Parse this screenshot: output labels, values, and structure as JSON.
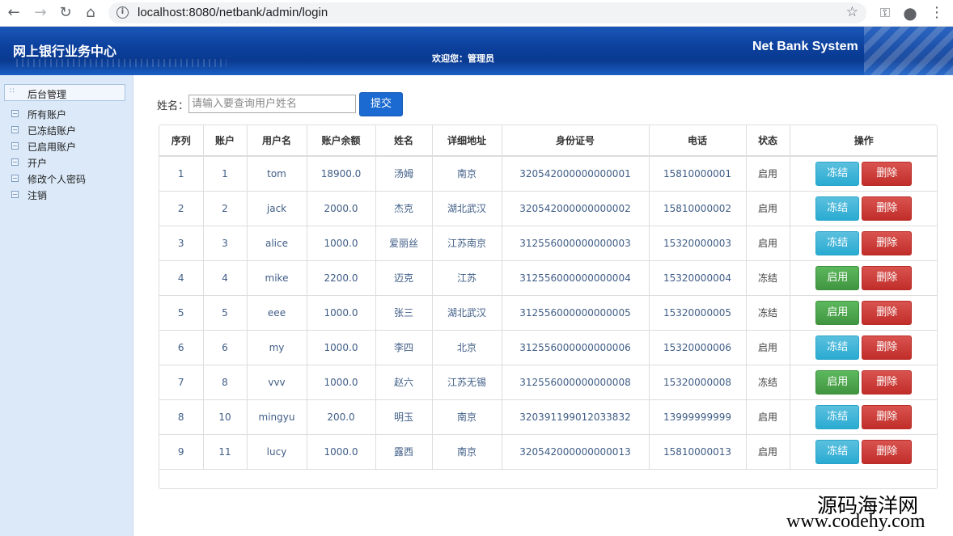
{
  "browser": {
    "url": "localhost:8080/netbank/admin/login"
  },
  "header": {
    "title_left": "网上银行业务中心",
    "welcome": "欢迎您：管理员",
    "title_right": "Net Bank System"
  },
  "sidebar": {
    "heading": "后台管理",
    "items": [
      {
        "label": "所有账户"
      },
      {
        "label": "已冻结账户"
      },
      {
        "label": "已启用账户"
      },
      {
        "label": "开户"
      },
      {
        "label": "修改个人密码"
      },
      {
        "label": "注销"
      }
    ]
  },
  "search": {
    "label": "姓名：",
    "placeholder": "请输入要查询用户姓名",
    "submit_label": "提交"
  },
  "table": {
    "columns": [
      "序列",
      "账户",
      "用户名",
      "账户余额",
      "姓名",
      "详细地址",
      "身份证号",
      "电话",
      "状态",
      "操作"
    ],
    "rows": [
      {
        "seq": "1",
        "account": "1",
        "username": "tom",
        "balance": "18900.0",
        "name": "汤姆",
        "address": "南京",
        "id_no": "320542000000000001",
        "phone": "15810000001",
        "status": "启用",
        "action": "冻结",
        "delete": "删除"
      },
      {
        "seq": "2",
        "account": "2",
        "username": "jack",
        "balance": "2000.0",
        "name": "杰克",
        "address": "湖北武汉",
        "id_no": "320542000000000002",
        "phone": "15810000002",
        "status": "启用",
        "action": "冻结",
        "delete": "删除"
      },
      {
        "seq": "3",
        "account": "3",
        "username": "alice",
        "balance": "1000.0",
        "name": "爱丽丝",
        "address": "江苏南京",
        "id_no": "312556000000000003",
        "phone": "15320000003",
        "status": "启用",
        "action": "冻结",
        "delete": "删除"
      },
      {
        "seq": "4",
        "account": "4",
        "username": "mike",
        "balance": "2200.0",
        "name": "迈克",
        "address": "江苏",
        "id_no": "312556000000000004",
        "phone": "15320000004",
        "status": "冻结",
        "action": "启用",
        "delete": "删除"
      },
      {
        "seq": "5",
        "account": "5",
        "username": "eee",
        "balance": "1000.0",
        "name": "张三",
        "address": "湖北武汉",
        "id_no": "312556000000000005",
        "phone": "15320000005",
        "status": "冻结",
        "action": "启用",
        "delete": "删除"
      },
      {
        "seq": "6",
        "account": "6",
        "username": "my",
        "balance": "1000.0",
        "name": "李四",
        "address": "北京",
        "id_no": "312556000000000006",
        "phone": "15320000006",
        "status": "启用",
        "action": "冻结",
        "delete": "删除"
      },
      {
        "seq": "7",
        "account": "8",
        "username": "vvv",
        "balance": "1000.0",
        "name": "赵六",
        "address": "江苏无锡",
        "id_no": "312556000000000008",
        "phone": "15320000008",
        "status": "冻结",
        "action": "启用",
        "delete": "删除"
      },
      {
        "seq": "8",
        "account": "10",
        "username": "mingyu",
        "balance": "200.0",
        "name": "明玉",
        "address": "南京",
        "id_no": "320391199012033832",
        "phone": "13999999999",
        "status": "启用",
        "action": "冻结",
        "delete": "删除"
      },
      {
        "seq": "9",
        "account": "11",
        "username": "lucy",
        "balance": "1000.0",
        "name": "露西",
        "address": "南京",
        "id_no": "320542000000000013",
        "phone": "15810000013",
        "status": "启用",
        "action": "冻结",
        "delete": "删除"
      }
    ]
  },
  "watermark": {
    "line1": "源码海洋网",
    "line2": "www.codehy.com"
  },
  "colors": {
    "banner": "#0b3f9b",
    "sidebar": "#dbe9f8",
    "primary_button": "#1b6ad1",
    "freeze_button": "#5bc0de",
    "enable_button": "#5cb85c",
    "delete_button": "#d9534f"
  },
  "icons": [
    "back-arrow-icon",
    "forward-arrow-icon",
    "reload-icon",
    "home-icon",
    "info-icon",
    "star-icon",
    "key-icon",
    "account-icon",
    "menu-dots-icon"
  ]
}
